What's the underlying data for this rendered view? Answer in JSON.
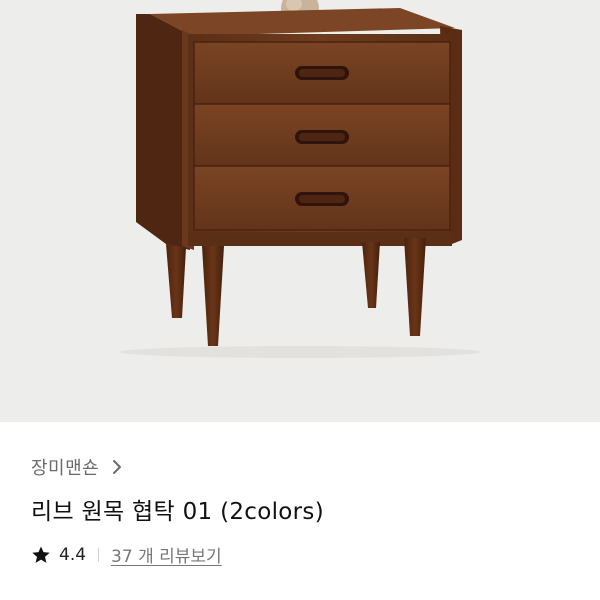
{
  "product": {
    "image_alt": "리브 원목 협탁 01 (2colors)",
    "brand": "장미맨숀",
    "title": "리브 원목 협탁 01 (2colors)",
    "rating": "4.4",
    "reviews_link": "37 개 리뷰보기"
  },
  "icons": {
    "brand_chevron": "chevron-right-icon",
    "rating_star": "star-icon"
  },
  "colors": {
    "image_background": "#ededeb",
    "wood": "#6b3a1d",
    "brand_text": "#6a6a6a",
    "title_text": "#111111",
    "review_link": "#777777"
  }
}
